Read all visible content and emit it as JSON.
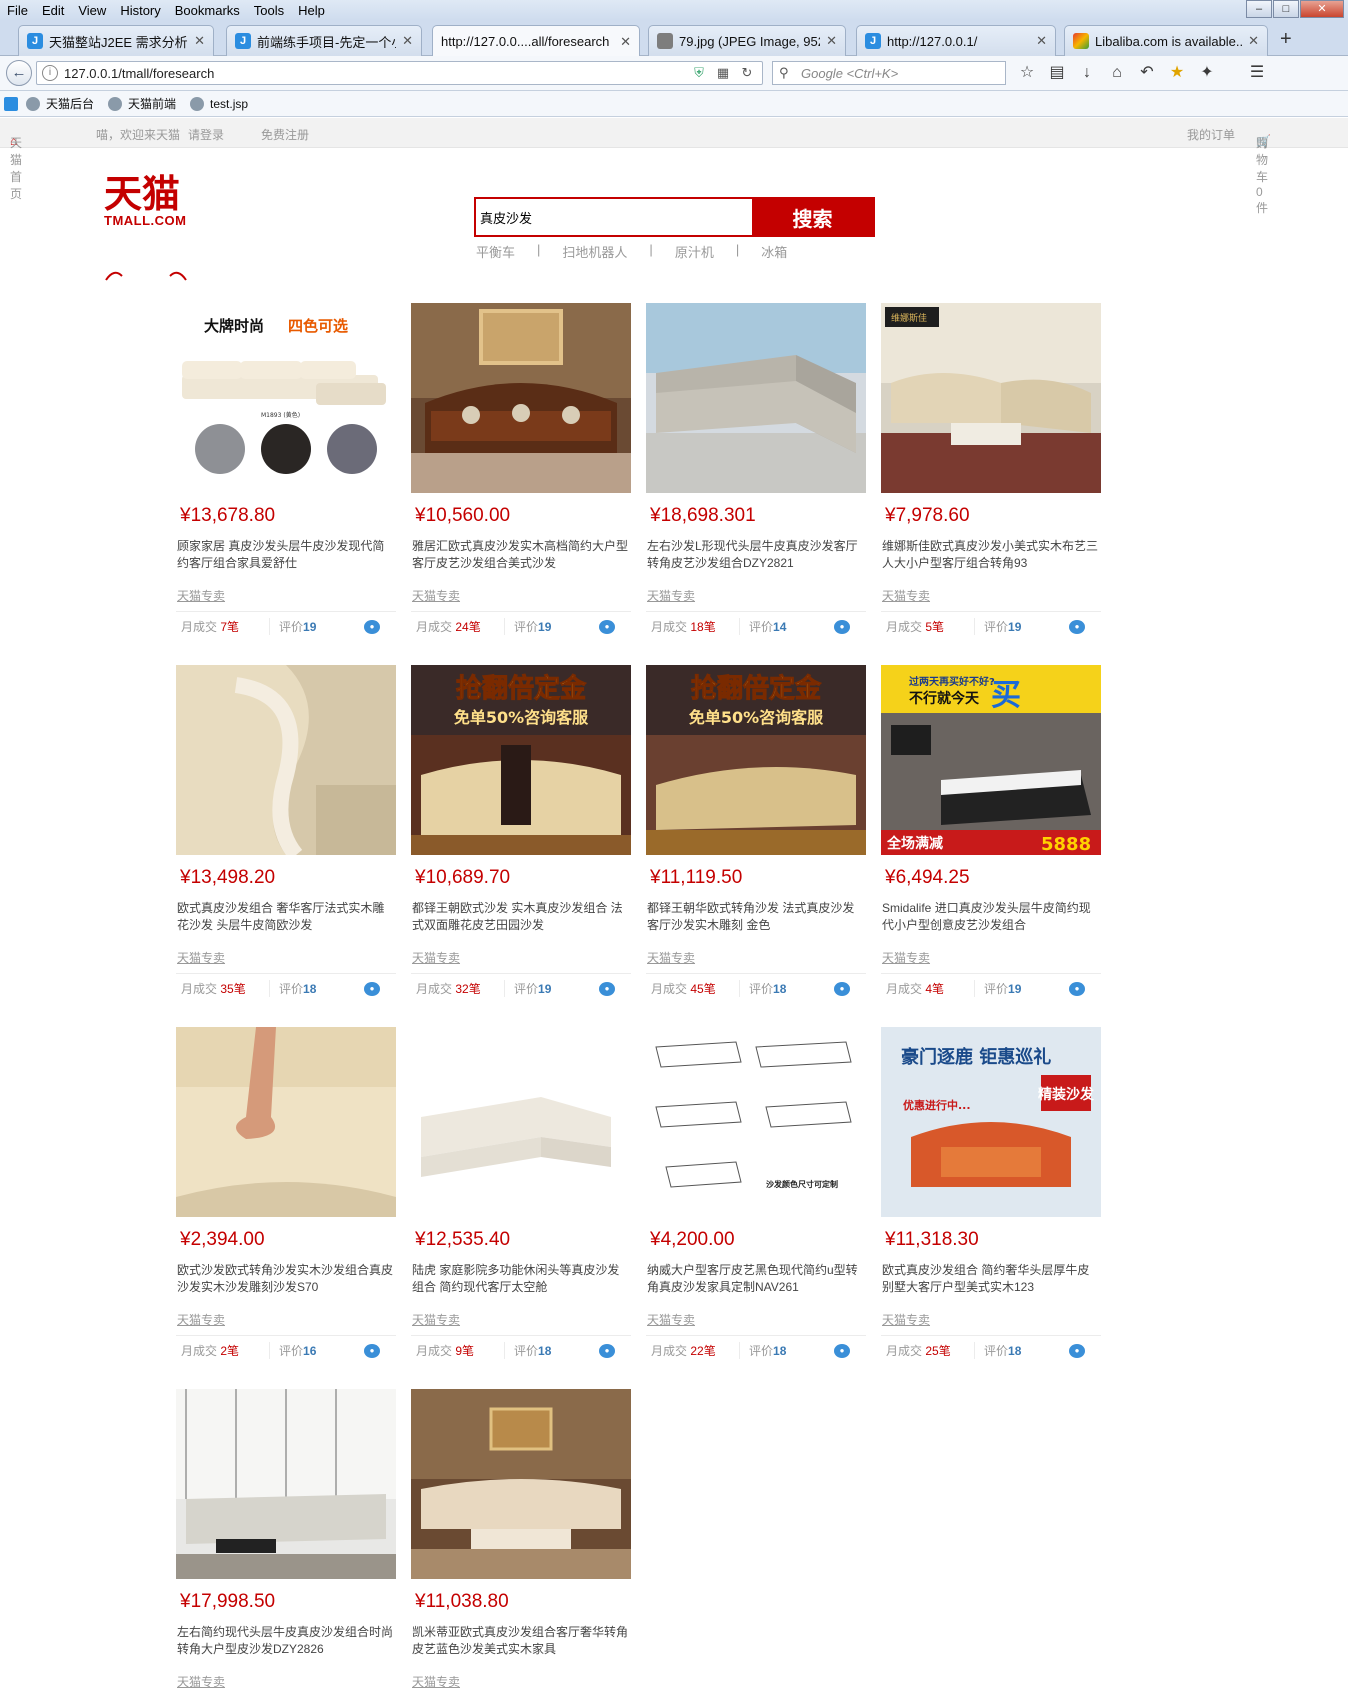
{
  "browser": {
    "menu": [
      "File",
      "Edit",
      "View",
      "History",
      "Bookmarks",
      "Tools",
      "Help"
    ],
    "tabs": [
      {
        "title": "天猫整站J2EE 需求分析-...",
        "icon": "j"
      },
      {
        "title": "前端练手项目-先定一个小...",
        "icon": "j"
      },
      {
        "title": "http://127.0.0....all/foresearch",
        "icon": "none"
      },
      {
        "title": "79.jpg (JPEG Image, 952...",
        "icon": "img"
      },
      {
        "title": "http://127.0.0.1/",
        "icon": "j"
      },
      {
        "title": "Libaliba.com is available...",
        "icon": "lib"
      }
    ],
    "url": "127.0.0.1/tmall/foresearch",
    "search_placeholder": "Google <Ctrl+K>",
    "bookmarks": [
      "天猫后台",
      "天猫前端",
      "test.jsp"
    ]
  },
  "topnav": {
    "home": "天猫首页",
    "welcome": "喵，欢迎来天猫",
    "login": "请登录",
    "register": "免费注册",
    "orders": "我的订单",
    "cart": "购物车0件"
  },
  "logo": {
    "cn": "天猫",
    "en": "TMALL.COM"
  },
  "search": {
    "value": "真皮沙发",
    "button": "搜索",
    "hot_words": [
      "平衡车",
      "扫地机器人",
      "原汁机",
      "冰箱"
    ]
  },
  "labels": {
    "sales": "月成交",
    "sales_unit": "笔",
    "reviews": "评价"
  },
  "products": [
    {
      "price": "¥13,678.80",
      "title": "顾家家居 真皮沙发头层牛皮沙发现代简约客厅组合家具爱舒仕",
      "shop": "天猫专卖",
      "sales": "7",
      "reviews": "19",
      "img": "ad"
    },
    {
      "price": "¥10,560.00",
      "title": "雅居汇欧式真皮沙发实木高档简约大户型客厅皮艺沙发组合美式沙发",
      "shop": "天猫专卖",
      "sales": "24",
      "reviews": "19",
      "img": "classic"
    },
    {
      "price": "¥18,698.301",
      "title": "左右沙发L形现代头层牛皮真皮沙发客厅转角皮艺沙发组合DZY2821",
      "shop": "天猫专卖",
      "sales": "18",
      "reviews": "14",
      "img": "grey"
    },
    {
      "price": "¥7,978.60",
      "title": "维娜斯佳欧式真皮沙发小美式实木布艺三人大小户型客厅组合转角93",
      "shop": "天猫专卖",
      "sales": "5",
      "reviews": "19",
      "img": "room"
    },
    {
      "price": "¥13,498.20",
      "title": "欧式真皮沙发组合 奢华客厅法式实木雕花沙发 头层牛皮简欧沙发",
      "shop": "天猫专卖",
      "sales": "35",
      "reviews": "18",
      "img": "closeup"
    },
    {
      "price": "¥10,689.70",
      "title": "都铎王朝欧式沙发 实木真皮沙发组合 法式双面雕花皮艺田园沙发",
      "shop": "天猫专卖",
      "sales": "32",
      "reviews": "19",
      "img": "promo"
    },
    {
      "price": "¥11,119.50",
      "title": "都铎王朝华欧式转角沙发 法式真皮沙发客厅沙发实木雕刻 金色",
      "shop": "天猫专卖",
      "sales": "45",
      "reviews": "18",
      "img": "promo2"
    },
    {
      "price": "¥6,494.25",
      "title": "Smidalife 进口真皮沙发头层牛皮简约现代小户型创意皮艺沙发组合",
      "shop": "天猫专卖",
      "sales": "4",
      "reviews": "19",
      "img": "banner"
    },
    {
      "price": "¥2,394.00",
      "title": "欧式沙发欧式转角沙发实木沙发组合真皮沙发实木沙发雕刻沙发S70",
      "shop": "天猫专卖",
      "sales": "2",
      "reviews": "16",
      "img": "foot"
    },
    {
      "price": "¥12,535.40",
      "title": "陆虎 家庭影院多功能休闲头等真皮沙发组合 简约现代客厅太空舱",
      "shop": "天猫专卖",
      "sales": "9",
      "reviews": "18",
      "img": "white"
    },
    {
      "price": "¥4,200.00",
      "title": "纳威大户型客厅皮艺黑色现代简约u型转角真皮沙发家具定制NAV261",
      "shop": "天猫专卖",
      "sales": "22",
      "reviews": "18",
      "img": "sketch"
    },
    {
      "price": "¥11,318.30",
      "title": "欧式真皮沙发组合 简约奢华头层厚牛皮别墅大客厅户型美式实木123",
      "shop": "天猫专卖",
      "sales": "25",
      "reviews": "18",
      "img": "orange"
    },
    {
      "price": "¥17,998.50",
      "title": "左右简约现代头层牛皮真皮沙发组合时尚转角大户型皮沙发DZY2826",
      "shop": "天猫专卖",
      "sales": "",
      "reviews": "",
      "img": "modern"
    },
    {
      "price": "¥11,038.80",
      "title": "凯米蒂亚欧式真皮沙发组合客厅奢华转角皮艺蓝色沙发美式实木家具",
      "shop": "天猫专卖",
      "sales": "",
      "reviews": "",
      "img": "luxury"
    }
  ],
  "image_text": {
    "ad_title_black": "大牌时尚",
    "ad_title_orange": "四色可选",
    "ad_model": "M1893 (黄色)",
    "promo_line1": "抢翻倍定金",
    "promo_line2": "免单50%咨询客服",
    "banner_q": "过两天再买好不好?",
    "banner_a": "不行就今天",
    "banner_buy": "买",
    "banner_sale": "全场满减",
    "banner_price": "5888",
    "orange_t1": "豪门逐鹿 钜惠巡礼",
    "orange_t2": "精装沙发",
    "orange_t3": "优惠进行中...",
    "sketch_note": "沙发颜色尺寸可定制",
    "room_brand": "维娜斯佳"
  },
  "colors": {
    "brand": "#c40000",
    "link": "#3b7ab4"
  }
}
